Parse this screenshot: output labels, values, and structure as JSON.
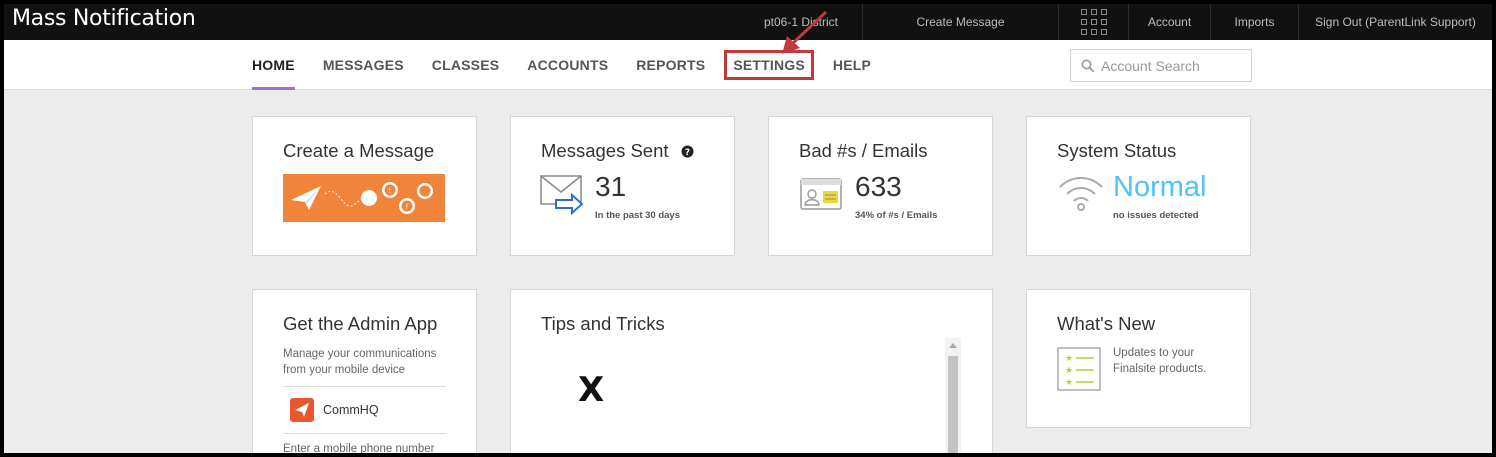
{
  "app": {
    "title": "Mass Notification"
  },
  "topnav": {
    "district": "pt06-1 District",
    "create_message": "Create Message",
    "apps_icon": "grid-icon",
    "account": "Account",
    "imports": "Imports",
    "sign_out": "Sign Out (ParentLink Support)"
  },
  "mainnav": {
    "tabs": [
      {
        "label": "HOME",
        "active": true
      },
      {
        "label": "MESSAGES"
      },
      {
        "label": "CLASSES"
      },
      {
        "label": "ACCOUNTS"
      },
      {
        "label": "REPORTS"
      },
      {
        "label": "SETTINGS",
        "highlighted": true
      },
      {
        "label": "HELP"
      }
    ],
    "search": {
      "placeholder": "Account Search",
      "icon": "search-icon"
    }
  },
  "cards": {
    "create_message": {
      "title": "Create a Message"
    },
    "messages_sent": {
      "title": "Messages Sent",
      "value": "31",
      "note": "In the past 30 days",
      "help_icon": "question-icon"
    },
    "bad_numbers": {
      "title": "Bad #s / Emails",
      "value": "633",
      "note": "34% of #s / Emails"
    },
    "system_status": {
      "title": "System Status",
      "value": "Normal",
      "note": "no issues detected"
    },
    "admin_app": {
      "title": "Get the Admin App",
      "description": "Manage your communications from your mobile device",
      "app_name": "CommHQ",
      "footer_cut": "Enter a mobile phone number"
    },
    "tips": {
      "title": "Tips and Tricks",
      "logo": "X"
    },
    "whats_new": {
      "title": "What's New",
      "text": "Updates to your Finalsite products."
    }
  },
  "colors": {
    "topbar_bg": "#111111",
    "accent_purple": "#a56bd1",
    "highlight_red": "#c0393b",
    "promo_orange": "#f0843a",
    "status_blue": "#4fc3f7"
  }
}
